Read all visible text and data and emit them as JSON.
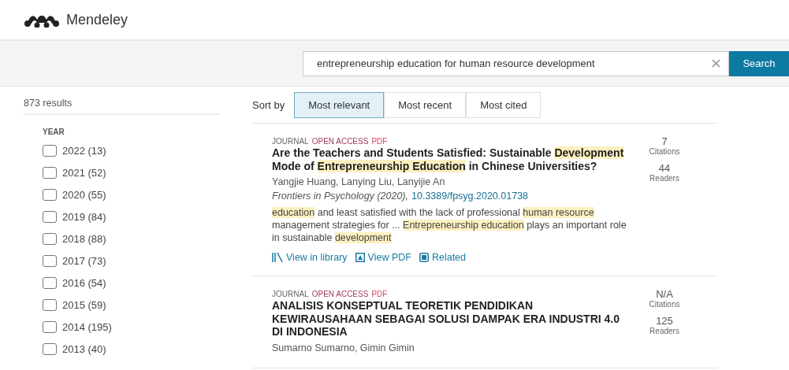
{
  "brand": {
    "name": "Mendeley"
  },
  "search": {
    "value": "entrepreneurship education for human resource development",
    "button": "Search"
  },
  "results_count": "873 results",
  "filters": {
    "heading": "YEAR",
    "items": [
      {
        "label": "2022 (13)",
        "checked": false
      },
      {
        "label": "2021 (52)",
        "checked": false
      },
      {
        "label": "2020 (55)",
        "checked": false
      },
      {
        "label": "2019 (84)",
        "checked": false
      },
      {
        "label": "2018 (88)",
        "checked": false
      },
      {
        "label": "2017 (73)",
        "checked": false
      },
      {
        "label": "2016 (54)",
        "checked": false
      },
      {
        "label": "2015 (59)",
        "checked": false
      },
      {
        "label": "2014 (195)",
        "checked": false
      },
      {
        "label": "2013 (40)",
        "checked": false
      }
    ]
  },
  "sort": {
    "label": "Sort by",
    "options": [
      {
        "label": "Most relevant",
        "selected": true
      },
      {
        "label": "Most recent",
        "selected": false
      },
      {
        "label": "Most cited",
        "selected": false
      }
    ]
  },
  "results": [
    {
      "type": "JOURNAL",
      "access": "OPEN ACCESS",
      "format": "PDF",
      "title": [
        {
          "text": "Are the Teachers and Students Satisfied: Sustainable ",
          "highlighted": false
        },
        {
          "text": "Development",
          "highlighted": true
        },
        {
          "text": " Mode of ",
          "highlighted": false
        },
        {
          "text": "Entrepreneurship",
          "highlighted": true
        },
        {
          "text": " Education",
          "highlighted": true
        },
        {
          "text": " in Chinese Universities?",
          "highlighted": false
        }
      ],
      "authors": "Yangjie Huang, Lanying Liu, Lanyijie An",
      "source": "Frontiers in Psychology (2020),",
      "doi": "10.3389/fpsyg.2020.01738",
      "snippet": [
        {
          "text": "education",
          "highlighted": true
        },
        {
          "text": " and least satisfied with the lack of professional ",
          "highlighted": false
        },
        {
          "text": "human resource",
          "highlighted": true
        },
        {
          "text": " management strategies for ... ",
          "highlighted": false
        },
        {
          "text": "Entrepreneurship",
          "highlighted": true
        },
        {
          "text": " education",
          "highlighted": true
        },
        {
          "text": " plays an important role in sustainable ",
          "highlighted": false
        },
        {
          "text": "development",
          "highlighted": true
        }
      ],
      "actions": [
        "View in library",
        "View PDF",
        "Related"
      ],
      "citations": "7",
      "citations_label": "Citations",
      "readers": "44",
      "readers_label": "Readers"
    },
    {
      "type": "JOURNAL",
      "access": "OPEN ACCESS",
      "format": "PDF",
      "title": [
        {
          "text": "ANALISIS KONSEPTUAL TEORETIK PENDIDIKAN KEWIRAUSAHAAN SEBAGAI SOLUSI DAMPAK ERA INDUSTRI 4.0 DI INDONESIA",
          "highlighted": false
        }
      ],
      "authors": "Sumarno Sumarno, Gimin Gimin",
      "citations": "N/A",
      "citations_label": "Citations",
      "readers": "125",
      "readers_label": "Readers"
    }
  ]
}
